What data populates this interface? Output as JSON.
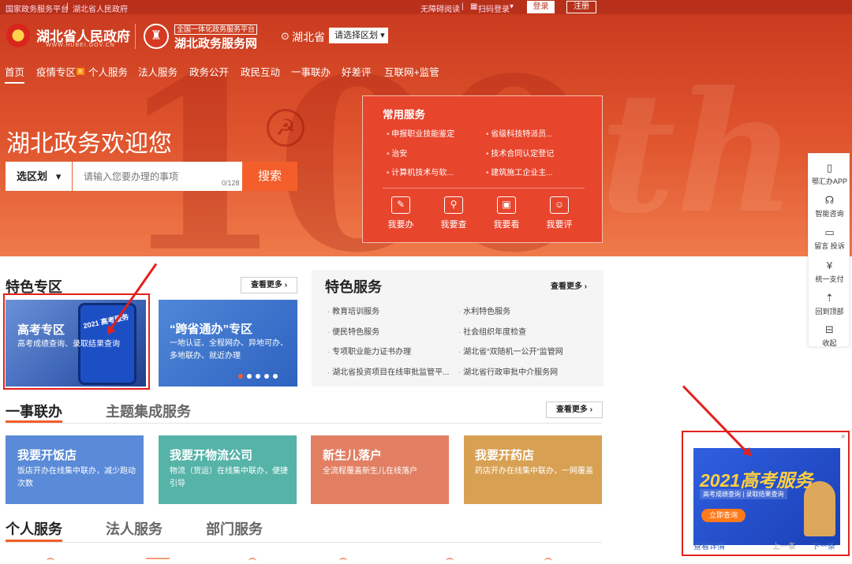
{
  "topbar": {
    "national": "国家政务服务平台",
    "provincial": "湖北省人民政府",
    "accessibility": "无障碍阅读",
    "scan_login": "扫码登录",
    "login": "登录",
    "register": "注册"
  },
  "header": {
    "gov_title": "湖北省人民政府",
    "gov_url": "WWW.HUBEI.GOV.CN",
    "platform_tag": "全国一体化政务服务平台",
    "platform_title": "湖北政务服务网",
    "region": "湖北省",
    "region_select": "请选择区划"
  },
  "nav": [
    "首页",
    "疫情专区",
    "新",
    "个人服务",
    "法人服务",
    "政务公开",
    "政民互动",
    "一事联办",
    "好差评",
    "互联网+监管"
  ],
  "hero": {
    "welcome": "湖北政务欢迎您",
    "select_region": "选区划",
    "search_placeholder": "请输入您要办理的事项",
    "char_count": "0/128",
    "search_button": "搜索"
  },
  "common": {
    "title": "常用服务",
    "links": [
      "申报职业技能鉴定",
      "省级科技特派员...",
      "治安",
      "技术合同认定登记",
      "计算机技术与软...",
      "建筑施工企业主..."
    ],
    "quick": [
      "我要办",
      "我要查",
      "我要看",
      "我要评"
    ]
  },
  "featured_zone": {
    "title": "特色专区",
    "more": "查看更多",
    "card1_title": "高考专区",
    "card1_sub": "高考成绩查询、录取结果查询",
    "card2_title": "“跨省通办”专区",
    "card2_sub": "一地认证、全程网办、异地可办、多地联办、就近办理",
    "card1_img_text": "2021 高考服务"
  },
  "featured_service": {
    "title": "特色服务",
    "more": "查看更多",
    "links": [
      "教育培训服务",
      "水利特色服务",
      "便民特色服务",
      "社会组织年度检查",
      "专项职业能力证书办理",
      "湖北省“双随机一公开”监管网",
      "湖北省投资项目在线审批监管平...",
      "湖北省行政审批中介服务网"
    ]
  },
  "one_thing": {
    "tab1": "一事联办",
    "tab2": "主题集成服务",
    "more": "查看更多",
    "cards": [
      {
        "title": "我要开饭店",
        "sub": "饭店开办在线集中联办，减少跑动次数",
        "color": "#5a8ad8"
      },
      {
        "title": "我要开物流公司",
        "sub": "物流（货运）在线集中联办，便捷引导",
        "color": "#55b3a8"
      },
      {
        "title": "新生儿落户",
        "sub": "全流程覆盖新生儿在线落户",
        "color": "#e27f63"
      },
      {
        "title": "我要开药店",
        "sub": "药店开办在线集中联办，一网覆盖",
        "color": "#d8a052"
      }
    ]
  },
  "services": {
    "tab1": "个人服务",
    "tab2": "法人服务",
    "tab3": "部门服务"
  },
  "sidebar": [
    "鄂汇办APP",
    "智能咨询",
    "留言 投诉",
    "统一支付",
    "回到顶部",
    "收起"
  ],
  "popup": {
    "headline": "2021高考服务",
    "sub": "高考成绩查询 | 录取结果查询",
    "cta": "立即查询",
    "detail": "查看详情",
    "prev": "上一条",
    "next": "下一条",
    "close": "×"
  },
  "colors": {
    "accent": "#f35e2a",
    "hero": "#d9462a",
    "annotation": "#e3211c"
  }
}
